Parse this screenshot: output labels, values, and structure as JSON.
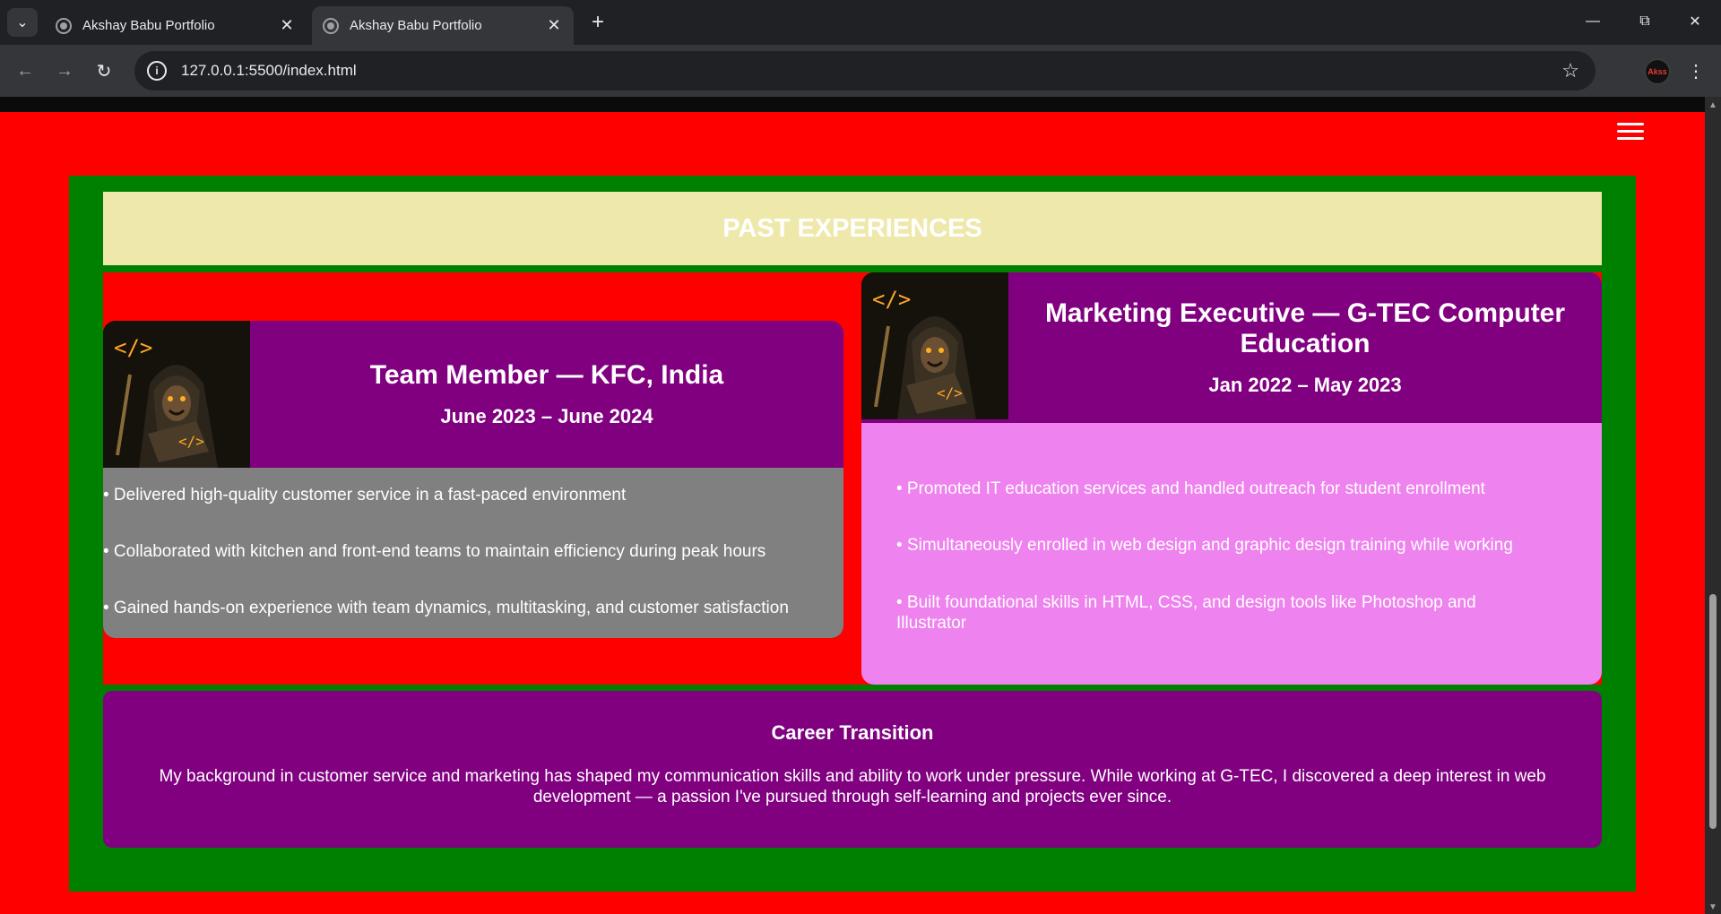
{
  "browser": {
    "tabs": [
      {
        "title": "Akshay Babu Portfolio",
        "active": false
      },
      {
        "title": "Akshay Babu Portfolio",
        "active": true
      }
    ],
    "url": "127.0.0.1:5500/index.html",
    "profile_initials": "Akss"
  },
  "page": {
    "section_title": "PAST EXPERIENCES",
    "experiences": [
      {
        "title": "Team Member — KFC, India",
        "dates": "June 2023 – June 2024",
        "bullets": [
          "• Delivered high-quality customer service in a fast-paced environment",
          "• Collaborated with kitchen and front-end teams to maintain efficiency during peak hours",
          "• Gained hands-on experience with team dynamics, multitasking, and customer satisfaction"
        ]
      },
      {
        "title": "Marketing Executive — G-TEC Computer Education",
        "dates": "Jan 2022 – May 2023",
        "bullets": [
          "• Promoted IT education services and handled outreach for student enrollment",
          "• Simultaneously enrolled in web design and graphic design training while working",
          "• Built foundational skills in HTML, CSS, and design tools like Photoshop and Illustrator"
        ]
      }
    ],
    "career_transition": {
      "heading": "Career Transition",
      "text": "My background in customer service and marketing has shaped my communication skills and ability to work under pressure. While working at G-TEC, I discovered a deep interest in web development — a passion I've pursued through self-learning and projects ever since."
    },
    "colors": {
      "page_bg": "#ff0000",
      "frame": "#008000",
      "header_band": "#eee8aa",
      "card_head": "#800080",
      "card1_body": "#808080",
      "card2_body": "#ee82ee"
    }
  }
}
